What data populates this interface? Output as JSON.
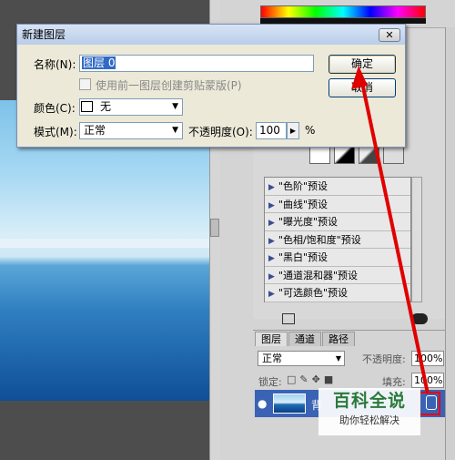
{
  "dialog": {
    "title": "新建图层",
    "close_label": "✕",
    "name_label": "名称(N):",
    "name_value": "图层 0",
    "clip_label": "使用前一图层创建剪贴蒙版(P)",
    "color_label": "颜色(C):",
    "color_value": "无",
    "mode_label": "模式(M):",
    "mode_value": "正常",
    "opacity_label": "不透明度(O):",
    "opacity_value": "100",
    "opacity_unit": "%",
    "ok_label": "确定",
    "cancel_label": "取消"
  },
  "adjustments": {
    "presets": [
      "\"色阶\"预设",
      "\"曲线\"预设",
      "\"曝光度\"预设",
      "\"色相/饱和度\"预设",
      "\"黑白\"预设",
      "\"通道混和器\"预设",
      "\"可选颜色\"预设"
    ]
  },
  "layers": {
    "tabs": [
      "图层",
      "通道",
      "路径"
    ],
    "blend_mode": "正常",
    "opacity_label": "不透明度:",
    "opacity_value": "100%",
    "lock_label": "锁定:",
    "fill_label": "填充:",
    "fill_value": "100%",
    "layer_name": "背"
  },
  "watermark": {
    "title": "百科全说",
    "subtitle": "助你轻松解决"
  },
  "colors": {
    "annotation": "#e00000",
    "selection": "#316ac5"
  }
}
